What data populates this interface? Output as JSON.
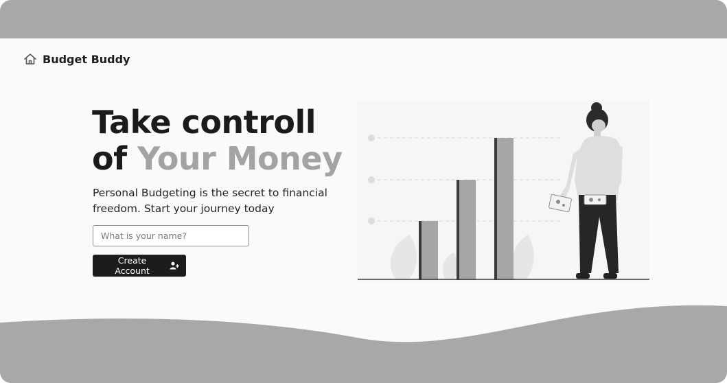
{
  "brand": {
    "name": "Budget Buddy",
    "icon": "home-icon"
  },
  "hero": {
    "title_line1": "Take controll",
    "title_of": "of ",
    "title_accent": "Your Money",
    "subtitle": "Personal Budgeting is the secret to financial freedom. Start your journey today"
  },
  "form": {
    "name_placeholder": "What is your name?",
    "name_value": "",
    "create_label": "Create Account",
    "create_icon": "user-plus-icon"
  },
  "colors": {
    "background": "#fafafa",
    "band": "#a8a8a8",
    "button": "#1c1c1c",
    "accent_text": "#a3a3a3"
  }
}
